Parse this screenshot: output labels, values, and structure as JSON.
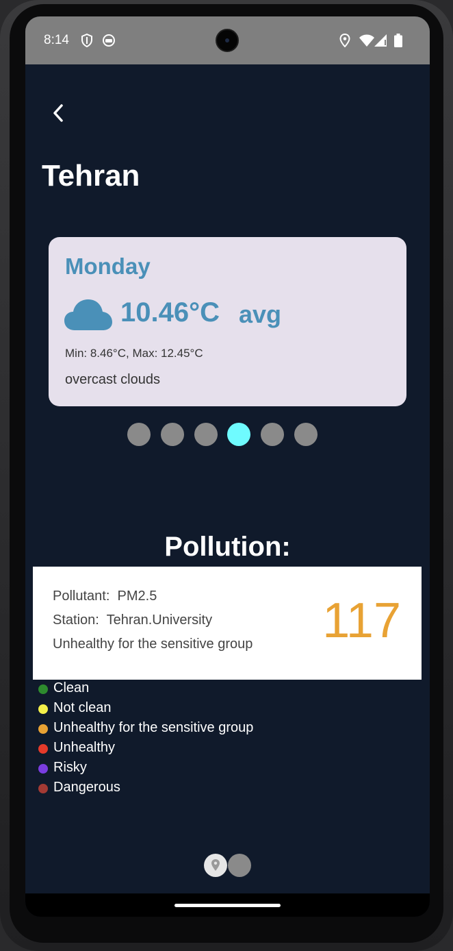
{
  "status_bar": {
    "time": "8:14",
    "icons": [
      "shield-icon",
      "app-notification-icon",
      "location-icon",
      "wifi-icon",
      "signal-icon",
      "battery-icon"
    ]
  },
  "header": {
    "back_icon": "chevron-left-icon",
    "city": "Tehran"
  },
  "weather_card": {
    "day": "Monday",
    "icon": "cloud-icon",
    "temperature": "10.46°C",
    "avg_label": "avg",
    "min_max": "Min: 8.46°C, Max: 12.45°C",
    "description": "overcast clouds"
  },
  "pager": {
    "count": 6,
    "active_index": 3
  },
  "pollution": {
    "heading": "Pollution:",
    "pollutant_label": "Pollutant:",
    "pollutant": "PM2.5",
    "station_label": "Station:",
    "station": "Tehran.University",
    "status": "Unhealthy for the sensitive group",
    "aqi": "117",
    "aqi_color": "#e8a234"
  },
  "legend": [
    {
      "label": "Clean",
      "color": "#2e8b2e"
    },
    {
      "label": "Not clean",
      "color": "#f5f04a"
    },
    {
      "label": "Unhealthy for the sensitive group",
      "color": "#e8a234"
    },
    {
      "label": "Unhealthy",
      "color": "#e53a2a"
    },
    {
      "label": "Risky",
      "color": "#7a3de0"
    },
    {
      "label": "Dangerous",
      "color": "#a33a34"
    }
  ],
  "bottom_tabs": [
    {
      "icon": "location-pin-icon",
      "active": true
    },
    {
      "icon": "",
      "active": false
    }
  ],
  "colors": {
    "background": "#101a2b",
    "card": "#e6e0ec",
    "accent": "#4a90b8",
    "active_dot": "#6ffbff",
    "inactive_dot": "#8a8a8a"
  }
}
